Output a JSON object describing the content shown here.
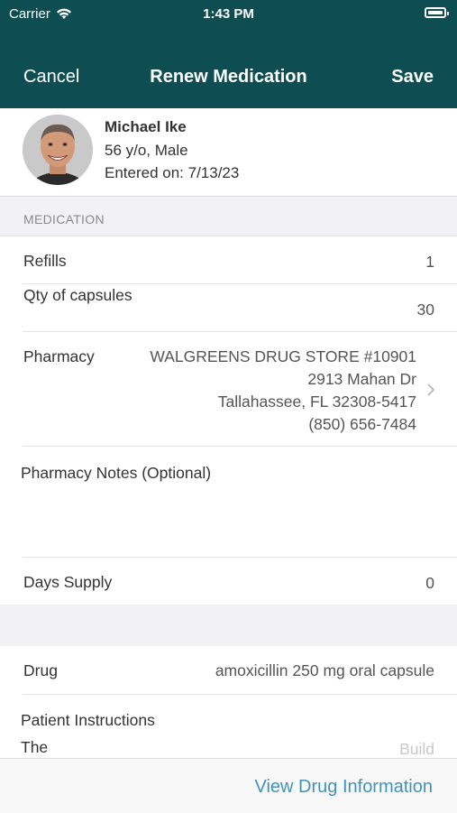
{
  "status": {
    "carrier": "Carrier",
    "time": "1:43 PM"
  },
  "nav": {
    "cancel_label": "Cancel",
    "title": "Renew Medication",
    "save_label": "Save"
  },
  "patient": {
    "name": "Michael Ike",
    "age_sex": "56 y/o, Male",
    "entered": "Entered on: 7/13/23"
  },
  "section": {
    "medication_header": "MEDICATION"
  },
  "form": {
    "refills": {
      "label": "Refills",
      "value": "1"
    },
    "qty": {
      "label": "Qty of capsules",
      "value": "30"
    },
    "pharmacy": {
      "label": "Pharmacy",
      "line1": "WALGREENS DRUG STORE #10901",
      "line2": "2913 Mahan Dr",
      "line3": "Tallahassee, FL 32308-5417",
      "line4": "(850) 656-7484"
    },
    "pharmacy_notes": {
      "label": "Pharmacy Notes (Optional)"
    },
    "days_supply": {
      "label": "Days Supply",
      "value": "0"
    },
    "drug": {
      "label": "Drug",
      "value": "amoxicillin 250 mg oral capsule"
    },
    "patient_instructions": {
      "label": "Patient Instructions",
      "text": "The",
      "placeholder": "Build"
    }
  },
  "footer": {
    "view_drug_info": "View Drug Information"
  },
  "colors": {
    "header_bg": "#0e4e53",
    "link": "#3f93b8"
  }
}
